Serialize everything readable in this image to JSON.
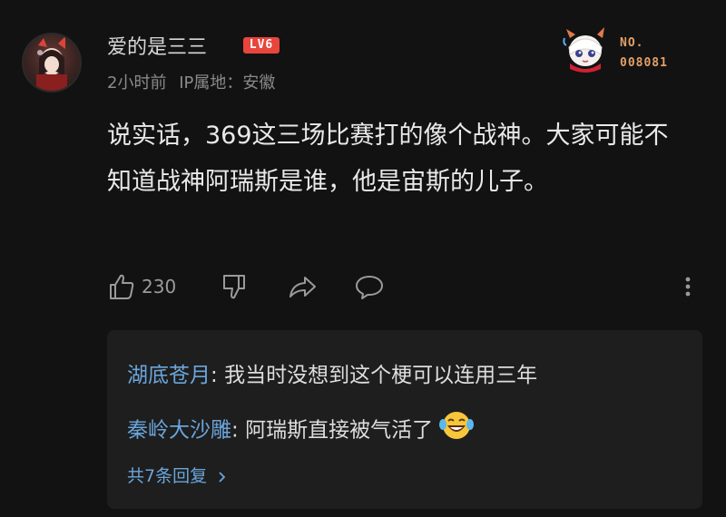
{
  "comment": {
    "username": "爱的是三三",
    "level_badge": "LV6",
    "time": "2小时前",
    "ip_location": "IP属地：安徽",
    "fan_badge": {
      "prefix": "NO.",
      "number": "008081"
    },
    "content": "说实话，369这三场比赛打的像个战神。大家可能不知道战神阿瑞斯是谁，他是宙斯的儿子。",
    "likes": "230",
    "icons": {
      "like": "thumb-up-icon",
      "dislike": "thumb-down-icon",
      "share": "share-icon",
      "reply": "comment-icon",
      "more": "more-vertical-icon"
    }
  },
  "replies": [
    {
      "name": "湖底苍月",
      "separator": ": ",
      "text": "我当时没想到这个梗可以连用三年"
    },
    {
      "name": "秦岭大沙雕",
      "separator": ": ",
      "text": "阿瑞斯直接被气活了",
      "emoji": "laughing-tears-emoji"
    }
  ],
  "more_replies": "共7条回复",
  "colors": {
    "background": "#121212",
    "reply_box": "#1e1e1e",
    "level_badge": "#e8453c",
    "link": "#6aa6dc",
    "fan_badge": "#e3a068"
  }
}
